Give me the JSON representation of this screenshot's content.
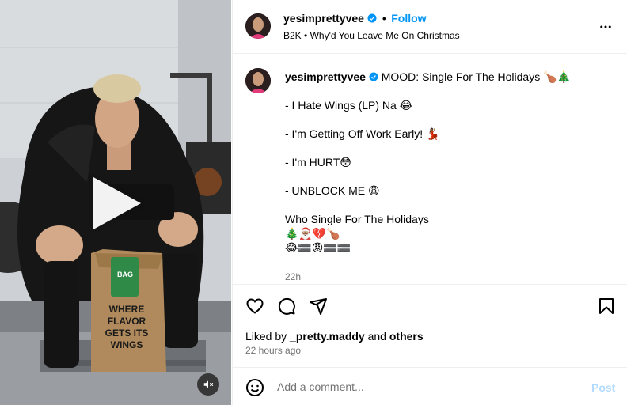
{
  "post": {
    "author": {
      "username": "yesimprettyvee",
      "verified": true,
      "follow_label": "Follow",
      "separator": "•"
    },
    "audio": {
      "artist": "B2K",
      "separator": "•",
      "track": "Why'd You Leave Me On Christmas"
    },
    "caption": {
      "username": "yesimprettyvee",
      "lines": [
        "MOOD: Single For The Holidays 🍗🎄",
        "- I Hate Wings (LP) Na 😂",
        "- I'm Getting Off Work Early! 💃🏾",
        "- I'm HURT😳",
        "- UNBLOCK ME 😩",
        "Who Single For The Holidays",
        "🎄🎅🏾💔🍗",
        "😂🟰😡🟰🟰"
      ],
      "timestamp": "22h"
    },
    "likes": {
      "prefix": "Liked by",
      "user": "_pretty.maddy",
      "joiner": "and",
      "others": "others"
    },
    "posted_ago": "22 hours ago",
    "comment": {
      "placeholder": "Add a comment...",
      "post_label": "Post"
    },
    "media": {
      "bag_text": "WHERE FLAVOR GETS ITS WINGS",
      "bag_label": "BAG"
    },
    "colors": {
      "link_blue": "#0095f6",
      "post_disabled": "#b3dbff",
      "muted_text": "#737373",
      "divider": "#efefef"
    },
    "icons": [
      "verified-badge-icon",
      "more-options-icon",
      "heart-icon",
      "comment-icon",
      "share-icon",
      "bookmark-icon",
      "emoji-icon",
      "play-icon",
      "mute-icon"
    ]
  }
}
